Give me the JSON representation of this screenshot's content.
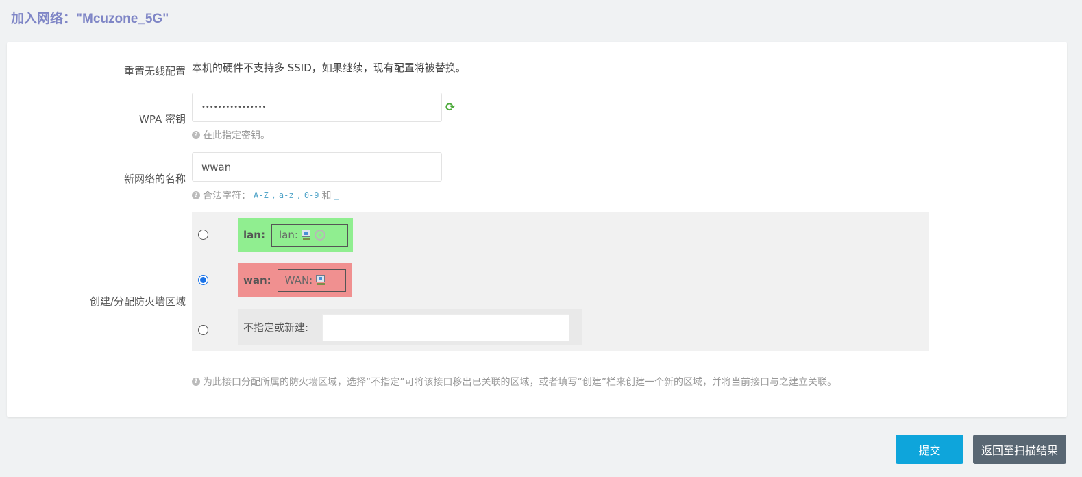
{
  "page": {
    "title": "加入网络：\"Mcuzone_5G\""
  },
  "form": {
    "reset_wireless": {
      "label": "重置无线配置",
      "text": "本机的硬件不支持多 SSID，如果继续，现有配置将被替换。"
    },
    "wpa_key": {
      "label": "WPA 密钥",
      "value": "••••••••••••••••",
      "hint": "在此指定密钥。",
      "refresh_icon": "refresh-icon"
    },
    "network_name": {
      "label": "新网络的名称",
      "value": "wwan",
      "hint_prefix": "合法字符：",
      "hint_code1": "A-Z",
      "hint_code2": "a-z",
      "hint_code3": "0-9",
      "hint_and": "和",
      "hint_code4": "_"
    },
    "firewall_zone": {
      "label": "创建/分配防火墙区域",
      "zones": [
        {
          "name": "lan:",
          "network": "lan:",
          "color": "#90ee90",
          "selected": false
        },
        {
          "name": "wan:",
          "network": "WAN:",
          "color": "#f09090",
          "selected": true
        }
      ],
      "unspecified_label": "不指定或新建:",
      "hint": "为此接口分配所属的防火墙区域，选择“不指定”可将该接口移出已关联的区域，或者填写“创建”栏来创建一个新的区域，并将当前接口与之建立关联。"
    }
  },
  "buttons": {
    "submit": "提交",
    "back": "返回至扫描结果"
  },
  "colors": {
    "title": "#7f86c6",
    "submit_bg": "#0ea5db",
    "back_bg": "#596773",
    "lan_zone": "#90ee90",
    "wan_zone": "#f09090"
  }
}
